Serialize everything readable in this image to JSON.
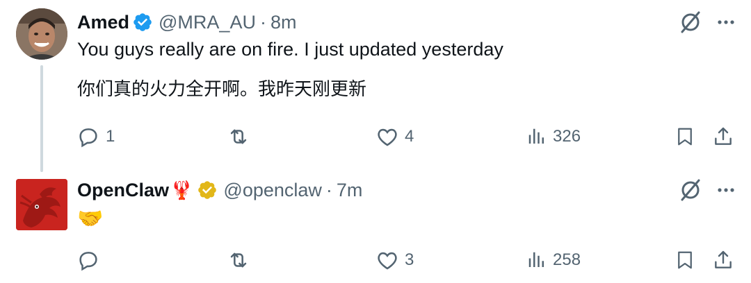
{
  "tweets": [
    {
      "author": {
        "display_name": "Amed",
        "handle": "@MRA_AU",
        "verified": "blue",
        "avatar": "person-photo"
      },
      "separator": "·",
      "time": "8m",
      "text_lines": [
        "You guys really are on fire. I just updated yesterday",
        "你们真的火力全开啊。我昨天刚更新"
      ],
      "stats": {
        "replies": "1",
        "retweets": "",
        "likes": "4",
        "views": "326"
      }
    },
    {
      "author": {
        "display_name": "OpenClaw",
        "name_emoji": "🦞",
        "handle": "@openclaw",
        "verified": "gold",
        "avatar": "red-lobster-logo"
      },
      "separator": "·",
      "time": "7m",
      "text": "🤝",
      "stats": {
        "replies": "",
        "retweets": "",
        "likes": "3",
        "views": "258"
      }
    }
  ],
  "colors": {
    "text_primary": "#0f1419",
    "text_secondary": "#536471",
    "verified_blue": "#1d9bf0",
    "verified_gold": "#e2b719",
    "thread_line": "#cfd9de"
  },
  "icons": [
    "reply-icon",
    "retweet-icon",
    "like-icon",
    "views-icon",
    "bookmark-icon",
    "share-icon",
    "grok-icon",
    "more-icon"
  ]
}
